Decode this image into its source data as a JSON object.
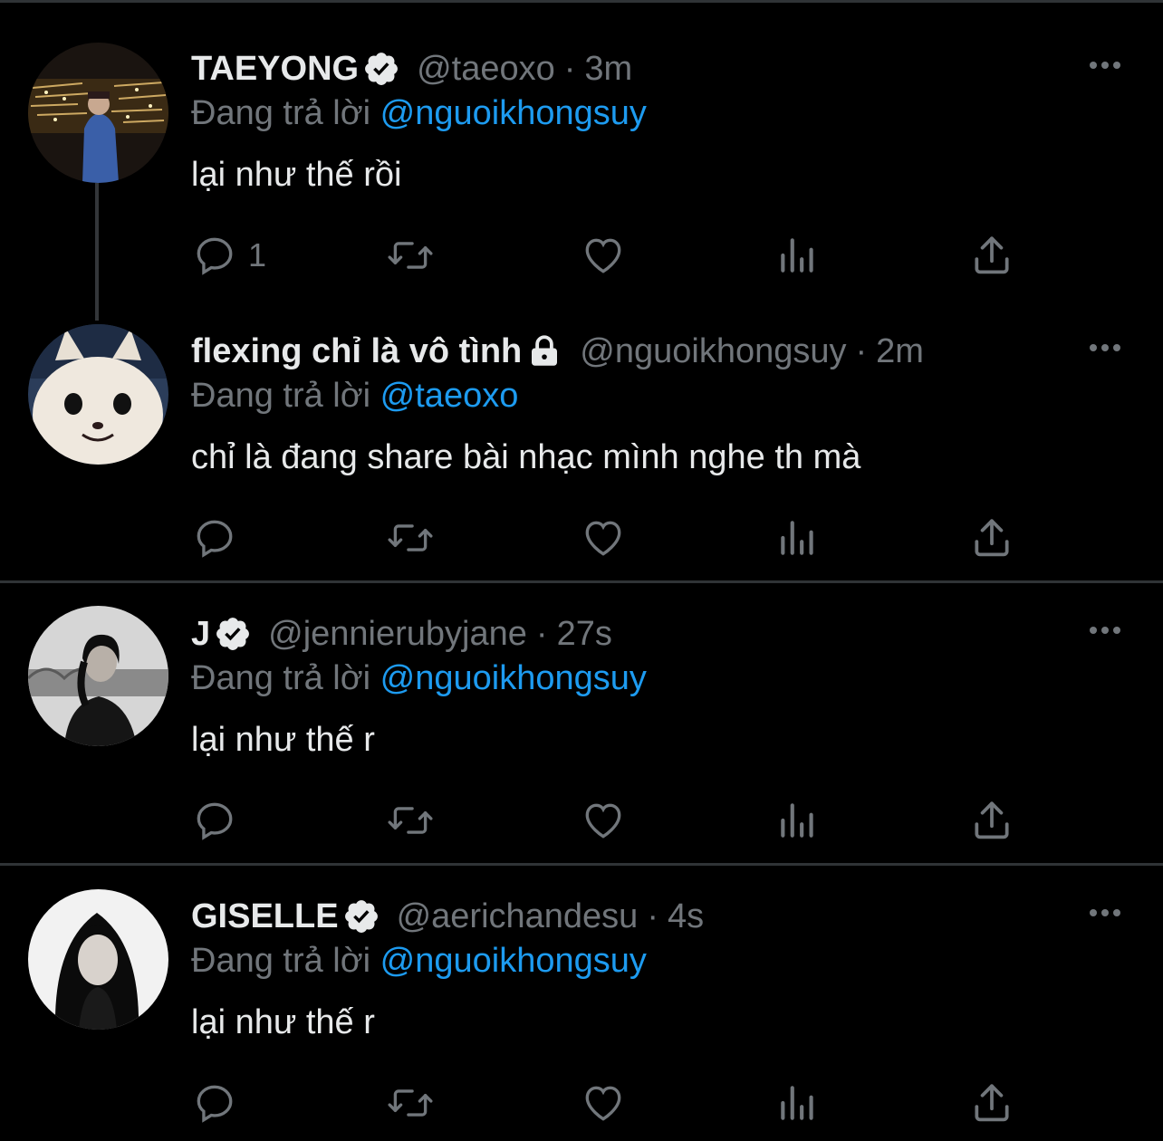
{
  "colors": {
    "background": "#000000",
    "primary_text": "#e7e9ea",
    "secondary_text": "#71767b",
    "link": "#1d9bf0",
    "divider": "#2f3336"
  },
  "icons": {
    "verified": "verified-badge-icon",
    "protected": "lock-icon",
    "more": "more-options-icon",
    "reply": "reply-icon",
    "retweet": "retweet-icon",
    "like": "heart-icon",
    "views": "views-icon",
    "share": "share-icon"
  },
  "tweets": [
    {
      "display_name": "TAEYONG",
      "badge": "verified",
      "handle": "@taeoxo",
      "separator": "·",
      "time": "3m",
      "reply_prefix": "Đang trả lời",
      "reply_to": "@nguoikhongsuy",
      "text": "lại như thế rồi",
      "reply_count": "1"
    },
    {
      "display_name": "flexing chỉ là vô tình",
      "badge": "protected",
      "handle": "@nguoikhongsuy",
      "separator": "·",
      "time": "2m",
      "reply_prefix": "Đang trả lời",
      "reply_to": "@taeoxo",
      "text": "chỉ là đang share bài nhạc mình nghe th mà",
      "reply_count": ""
    },
    {
      "display_name": "J",
      "badge": "verified",
      "handle": "@jennierubyjane",
      "separator": "·",
      "time": "27s",
      "reply_prefix": "Đang trả lời",
      "reply_to": "@nguoikhongsuy",
      "text": "lại như thế r",
      "reply_count": ""
    },
    {
      "display_name": "GISELLE",
      "badge": "verified",
      "handle": "@aerichandesu",
      "separator": "·",
      "time": "4s",
      "reply_prefix": "Đang trả lời",
      "reply_to": "@nguoikhongsuy",
      "text": "lại như thế r",
      "reply_count": ""
    }
  ]
}
